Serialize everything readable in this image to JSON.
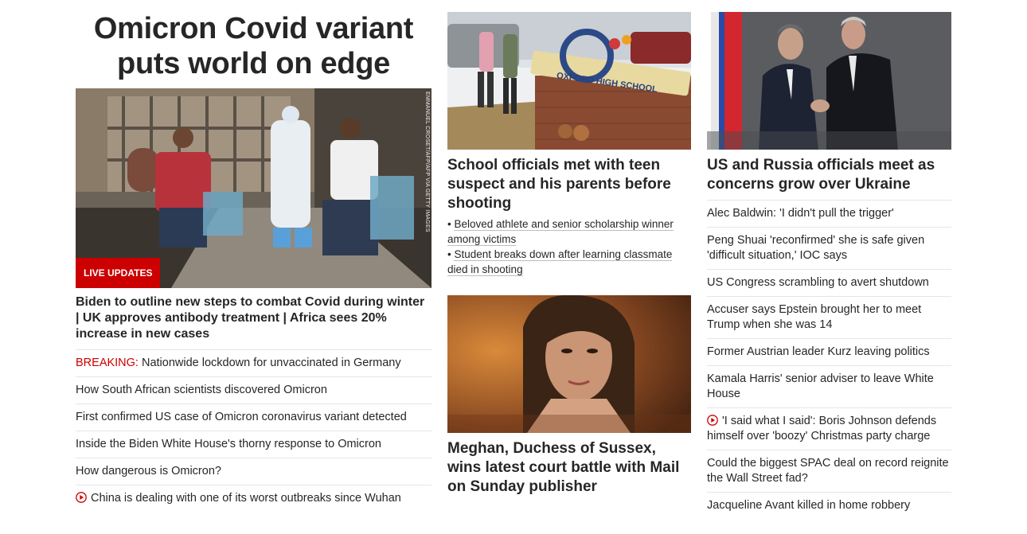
{
  "left": {
    "hero_title": "Omicron Covid variant puts world on edge",
    "photo_credit": "EMMANUEL CROSET/AFP/AFP VIA GETTY IMAGES",
    "live_badge": "LIVE UPDATES",
    "lead_headline": "Biden to outline new steps to combat Covid during winter | UK approves antibody treatment | Africa sees 20% increase in new cases",
    "breaking_label": "BREAKING:",
    "breaking_text": " Nationwide lockdown for unvaccinated in Germany",
    "stories": [
      "How South African scientists discovered Omicron",
      "First confirmed US case of Omicron coronavirus variant detected",
      "Inside the Biden White House's thorny response to Omicron",
      "How dangerous is Omicron?"
    ],
    "video_story": "China is dealing with one of its worst outbreaks since Wuhan"
  },
  "middle": {
    "card1": {
      "sign_text": "OXFORD HIGH SCHOOL",
      "headline": "School officials met with teen suspect and his parents before shooting",
      "sub_links": [
        "Beloved athlete and senior scholarship winner among victims",
        "Student breaks down after learning classmate died in shooting"
      ]
    },
    "card2": {
      "headline": "Meghan, Duchess of Sussex, wins latest court battle with Mail on Sunday publisher"
    }
  },
  "right": {
    "headline": "US and Russia officials meet as concerns grow over Ukraine",
    "stories": [
      {
        "text": "Alec Baldwin: 'I didn't pull the trigger'",
        "video": false
      },
      {
        "text": "Peng Shuai 'reconfirmed' she is safe given 'difficult situation,' IOC says",
        "video": false
      },
      {
        "text": "US Congress scrambling to avert shutdown",
        "video": false
      },
      {
        "text": "Accuser says Epstein brought her to meet Trump when she was 14",
        "video": false
      },
      {
        "text": "Former Austrian leader Kurz leaving politics",
        "video": false
      },
      {
        "text": "Kamala Harris' senior adviser to leave White House",
        "video": false
      },
      {
        "text": "'I said what I said': Boris Johnson defends himself over 'boozy' Christmas party charge",
        "video": true
      },
      {
        "text": "Could the biggest SPAC deal on record reignite the Wall Street fad?",
        "video": false
      },
      {
        "text": "Jacqueline Avant killed in home robbery",
        "video": false
      }
    ]
  },
  "colors": {
    "accent_red": "#cc0000",
    "text": "#262626",
    "divider": "#e6e6e6"
  }
}
